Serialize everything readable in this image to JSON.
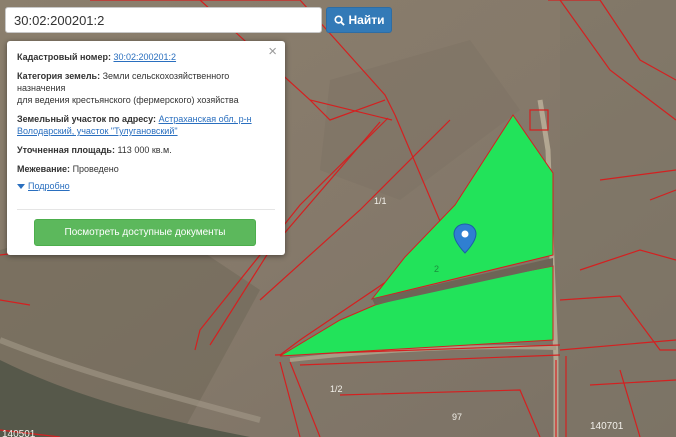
{
  "search": {
    "value": "30:02:200201:2",
    "button_label": "Найти"
  },
  "popup": {
    "close_symbol": "×",
    "cadastral_label": "Кадастровый номер:",
    "cadastral_value": "30:02:200201:2",
    "category_label": "Категория земель:",
    "category_value_line1": "Земли сельскохозяйственного",
    "category_value_line2": "назначения",
    "category_value_line3": "для ведения крестьянского (фермерского) хозяйства",
    "address_label": "Земельный участок по адресу:",
    "address_value_line1": "Астраханская обл, р-н",
    "address_value_line2": "Володарский, участок \"Тулугановский\"",
    "area_label": "Уточненная площадь:",
    "area_value": "113 000 кв.м.",
    "survey_label": "Межевание:",
    "survey_value": "Проведено",
    "details_label": "Подробно",
    "docs_button": "Посмотреть доступные документы"
  },
  "map": {
    "labels": {
      "l1": "1/1",
      "l2": "1/2",
      "l3": "2",
      "l4": "97",
      "l5": "140701",
      "l6": "140501"
    },
    "colors": {
      "parcel_highlight": "#22e35a",
      "boundary": "#d42020",
      "marker": "#2f7fd1"
    },
    "icons": [
      "search-icon",
      "close-icon",
      "chevron-down-icon",
      "map-marker-icon"
    ]
  }
}
